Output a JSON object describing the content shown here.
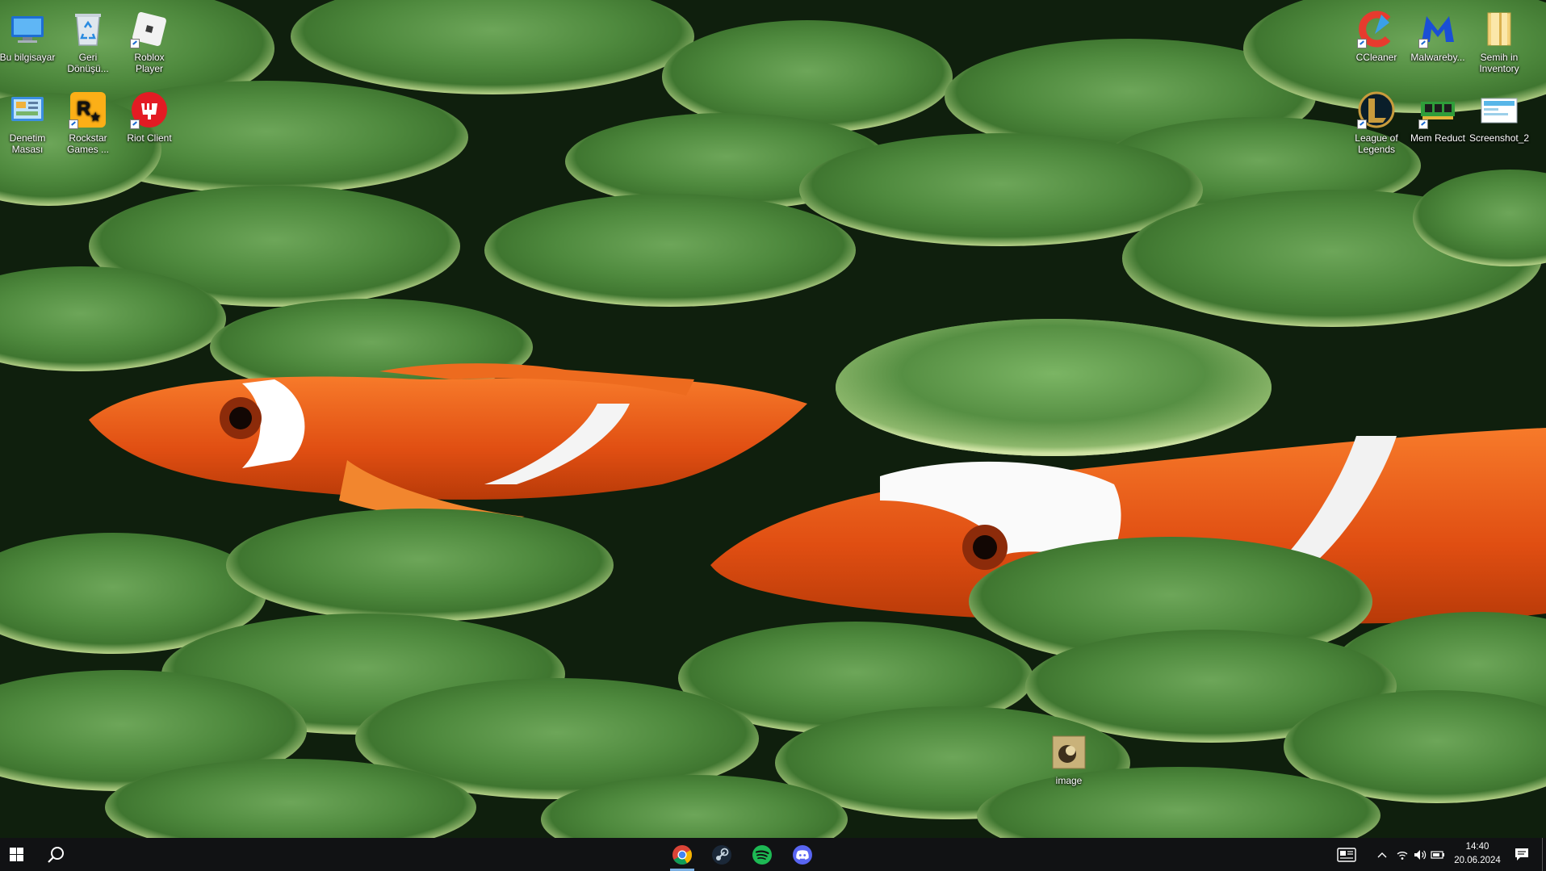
{
  "desktop": {
    "icons": [
      {
        "id": "this-pc",
        "label": "Bu bilgisayar"
      },
      {
        "id": "recycle-bin",
        "label": "Geri Dönüşü..."
      },
      {
        "id": "roblox",
        "label": "Roblox Player"
      },
      {
        "id": "control-panel",
        "label": "Denetim Masası"
      },
      {
        "id": "rockstar",
        "label": "Rockstar Games ..."
      },
      {
        "id": "riot",
        "label": "Riot Client"
      },
      {
        "id": "ccleaner",
        "label": "CCleaner"
      },
      {
        "id": "malwarebytes",
        "label": "Malwareby..."
      },
      {
        "id": "inventory",
        "label": "Semih in Inventory"
      },
      {
        "id": "lol",
        "label": "League of Legends"
      },
      {
        "id": "memreduct",
        "label": "Mem Reduct"
      },
      {
        "id": "screenshot",
        "label": "Screenshot_2"
      },
      {
        "id": "image",
        "label": "image"
      }
    ]
  },
  "taskbar": {
    "apps": [
      {
        "name": "Google Chrome",
        "icon": "chrome-icon",
        "active": true
      },
      {
        "name": "Steam",
        "icon": "steam-icon",
        "active": false
      },
      {
        "name": "Spotify",
        "icon": "spotify-icon",
        "active": false
      },
      {
        "name": "Discord",
        "icon": "discord-icon",
        "active": false
      }
    ],
    "clock": {
      "time": "14:40",
      "date": "20.06.2024"
    }
  },
  "colors": {
    "taskbar_bg": "#111214",
    "active_indicator": "#7aaee0",
    "anemone_green": "#4f8a3e",
    "clownfish_orange": "#e8561a"
  }
}
